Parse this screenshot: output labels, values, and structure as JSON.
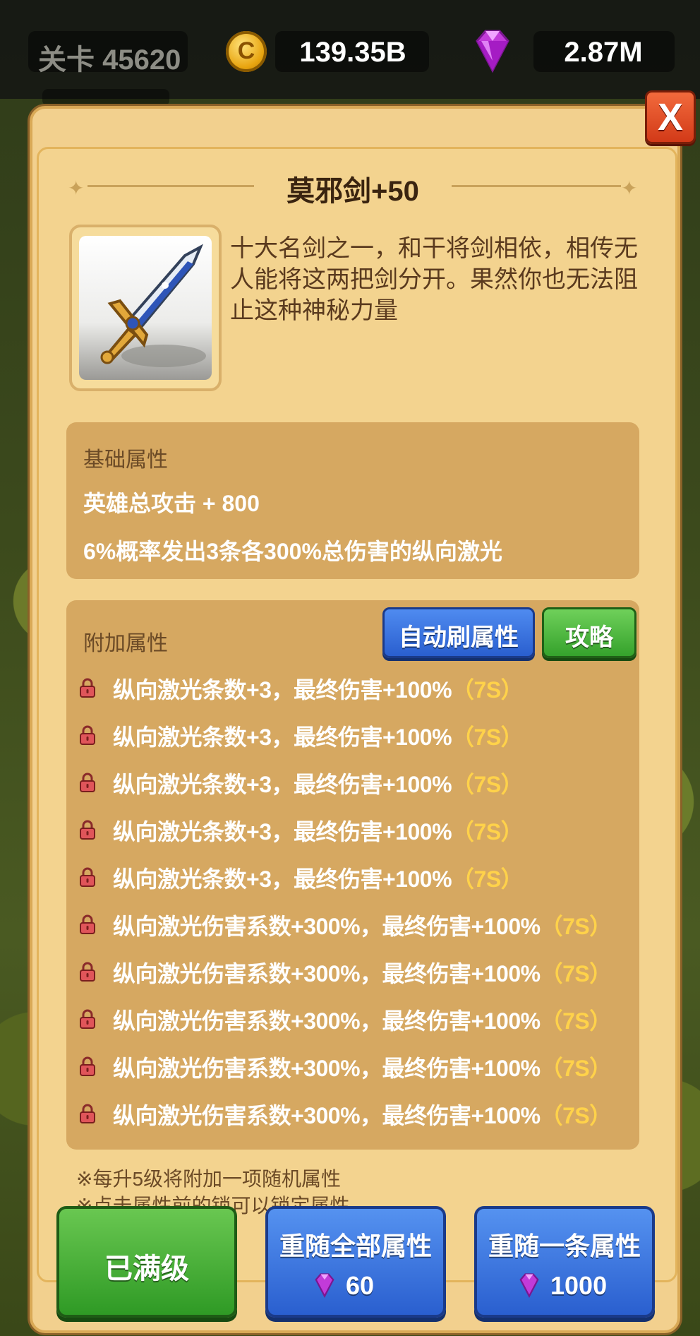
{
  "hud": {
    "level": "关卡 45620",
    "coins": "139.35B",
    "coin_symbol": "C",
    "gems": "2.87M"
  },
  "close_label": "X",
  "item": {
    "title": "莫邪剑+50",
    "description": "十大名剑之一，和干将剑相依，相传无人能将这两把剑分开。果然你也无法阻止这种神秘力量"
  },
  "base": {
    "label": "基础属性",
    "lines": [
      "英雄总攻击 + 800",
      "6%概率发出3条各300%总伤害的纵向激光"
    ]
  },
  "extra": {
    "label": "附加属性",
    "auto_button": "自动刷属性",
    "guide_button": "攻略",
    "attributes": [
      {
        "text": "纵向激光条数+3，最终伤害+100%",
        "tag": "（7S）"
      },
      {
        "text": "纵向激光条数+3，最终伤害+100%",
        "tag": "（7S）"
      },
      {
        "text": "纵向激光条数+3，最终伤害+100%",
        "tag": "（7S）"
      },
      {
        "text": "纵向激光条数+3，最终伤害+100%",
        "tag": "（7S）"
      },
      {
        "text": "纵向激光条数+3，最终伤害+100%",
        "tag": "（7S）"
      },
      {
        "text": "纵向激光伤害系数+300%，最终伤害+100%",
        "tag": "（7S）"
      },
      {
        "text": "纵向激光伤害系数+300%，最终伤害+100%",
        "tag": "（7S）"
      },
      {
        "text": "纵向激光伤害系数+300%，最终伤害+100%",
        "tag": "（7S）"
      },
      {
        "text": "纵向激光伤害系数+300%，最终伤害+100%",
        "tag": "（7S）"
      },
      {
        "text": "纵向激光伤害系数+300%，最终伤害+100%",
        "tag": "（7S）"
      }
    ]
  },
  "notes": [
    "※每升5级将附加一项随机属性",
    "※点击属性前的锁可以锁定属性"
  ],
  "buttons": {
    "maxed": "已满级",
    "reroll_all": {
      "label": "重随全部属性",
      "cost": "60"
    },
    "reroll_one": {
      "label": "重随一条属性",
      "cost": "1000"
    }
  },
  "colors": {
    "accent_gold": "#ffd24a",
    "button_blue": "#2a5fcf",
    "button_green": "#35a22c",
    "gem_purple": "#c23bd9"
  }
}
